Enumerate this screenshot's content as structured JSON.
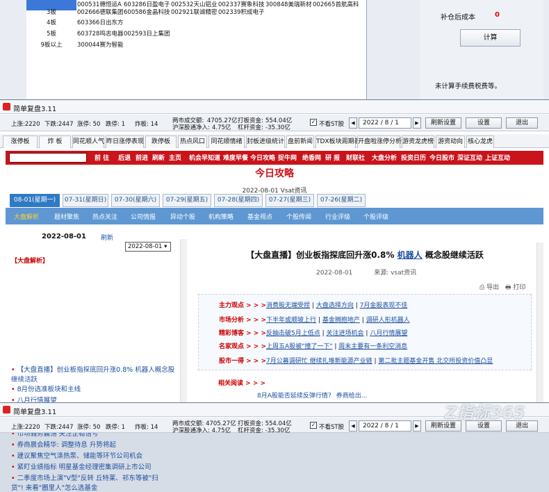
{
  "bg_table": {
    "rows": [
      {
        "level": "",
        "stocks": [
          "000531穗恒运A",
          "603286日盈电子",
          "002532天山铝业",
          "002337赛象科技",
          "300848美瑞新材",
          "002665首航高科"
        ],
        "selected": true
      },
      {
        "level": "3板",
        "stocks": [
          "002666德联集团",
          "600586金晶科技",
          "002921联诚精密",
          "002339积成电子"
        ],
        "selected": false
      },
      {
        "level": "4板",
        "stocks": [
          "603366日出东方"
        ],
        "selected": false
      },
      {
        "level": "5板",
        "stocks": [
          "603728鸣志电器",
          "002593日上集团"
        ],
        "selected": false
      },
      {
        "level": "9板以上",
        "stocks": [
          "300044赛为智能"
        ],
        "selected": false
      }
    ]
  },
  "bg_calc": {
    "label": "补仓后成本",
    "value": "0",
    "button": "计算",
    "note": "未计算手续费税费等。"
  },
  "window": {
    "title": "简单复盘3.11",
    "stats": {
      "up": "上涨:2220",
      "down": "下跌:2447",
      "limit_up": "涨停: 50",
      "limit_down": "跌停: 1",
      "blowup": "炸板: 14",
      "turnover_label": "两市成交额:",
      "turnover": "4705.27亿",
      "hk_label": "沪深股通净入:",
      "hk": "4.75亿",
      "hit_label": "打板资金:",
      "hit": "554.04亿",
      "lev_label": "杠杆资金:",
      "lev": "-35.30亿"
    },
    "no_st_label": "不看ST股",
    "no_st_checked": true,
    "date": "2022 / 8 / 1",
    "buttons": {
      "refresh": "刷新设置",
      "settings": "设置",
      "exit": "退出"
    }
  },
  "tabs": [
    "涨停板",
    "炸 板",
    "同花顺人气",
    "昨日涨停表现",
    "跌停板",
    "热点风口",
    "同花顺情绪",
    "封板进级统计",
    "盘前新闻",
    "TDX板块周期表",
    "开盘啦涨停分析",
    "游资龙虎榜",
    "游资动向",
    "核心龙虎"
  ],
  "active_tab": 8,
  "navbar": [
    "前 往",
    "后退",
    "前进",
    "刷新",
    "主页",
    "机会早知道",
    "难度早餐",
    "今日攻略",
    "捉牛网",
    "绝香网",
    "研 报",
    "财联社",
    "大盘分析",
    "投资日历",
    "今日股市",
    "深证互动",
    "上证互动"
  ],
  "headline": "今日攻略",
  "headline_sub": "2022-08-01  Vsat资讯",
  "date_tabs": [
    "08-01(星期一)",
    "07-31(星期日)",
    "07-30(星期六)",
    "07-29(星期五)",
    "07-28(星期四)",
    "07-27(星期三)",
    "07-26(星期二)"
  ],
  "categories": [
    "大盘解析",
    "题材聚焦",
    "热点关注",
    "公司情报",
    "异动个股",
    "机构策略",
    "基金视点",
    "个股传闻",
    "行业评级",
    "个股评级"
  ],
  "left_panel": {
    "date": "2022-08-01",
    "refresh": "刷新",
    "select_value": "2022-08-01 ▾",
    "section": "【大盘解析】",
    "items": [
      "【大盘直播】创业板指探底回升涨0.8% 机器人概念股",
      "继续活跃",
      "8月份选准板块和主线",
      "八月行情展望",
      "三条利空可能影响开门红",
      "交易情绪正快速恢复 市场有望延续普涨",
      "市场弱势震荡 关注企稳信号",
      "券商晨会精华: 调整待息 升势将起",
      "建议聚焦空气涤热泵、储能等环节公司机会",
      "紧盯业绩指标 明星基金经理密集调研上市公司",
      "二季度市场上演\"V型\"反转 丘特莱、祁东等被\"扫",
      "货\"! 来看\"圈里人\"怎么选基金"
    ]
  },
  "article": {
    "title_pre": "【大盘直播】创业板指探底回升涨0.8%",
    "title_link": "机器人",
    "title_post": "概念股继续活跃",
    "date": "2022-08-01",
    "source": "来源: vsat资讯",
    "export": "导出",
    "print": "打印",
    "rows": [
      {
        "label": "主力观点 > > >",
        "links": [
          "消费股无端受捏",
          "大盘选择方向",
          "7月金股表现不佳"
        ]
      },
      {
        "label": "市场分析 > > >",
        "links": [
          "下半年或顺坡上行",
          "基金拥抱地产",
          "调研人形机器人"
        ]
      },
      {
        "label": "精彩博客 > > >",
        "links": [
          "反抽击破5月上低点",
          "关注进场机会",
          "八月行情展望"
        ]
      },
      {
        "label": "名家观点 > > >",
        "links": [
          "上周五A股被\"撞了一下\"",
          "周末主要有一条利空消息"
        ]
      },
      {
        "label": "股市一得 > > >",
        "links": [
          "7月公募调研忙 继续扎堆新能源产业链",
          "第二批主题基金开售 北交所投资价值凸显"
        ]
      }
    ],
    "related": "相关阅读 > > >",
    "partial": "8月A股能否延续反弹行情？ 券商给出..."
  },
  "bottom_window": {
    "title": "简单复盘3.11",
    "up": "上涨:2220",
    "down": "下跌:2447",
    "limit_up": "涨停: 50",
    "limit_down": "跌停: 1",
    "blowup": "炸板: 14",
    "turnover": "两市成交额: 4705.27亿",
    "hk": "沪深股通净入: 4.75亿",
    "hit": "打板资金: 554.04亿",
    "lev": "杠杆资金: -35.30亿",
    "no_st_label": "不看ST股",
    "date": "2022 / 8 / 1",
    "buttons": {
      "refresh": "刷新设置",
      "settings": "设置",
      "exit": "退出"
    }
  },
  "watermark": "Z指标365",
  "colors": {
    "accent_red": "#c9141b",
    "blue_bar": "#5e97d2",
    "link": "#1c4fa0"
  }
}
